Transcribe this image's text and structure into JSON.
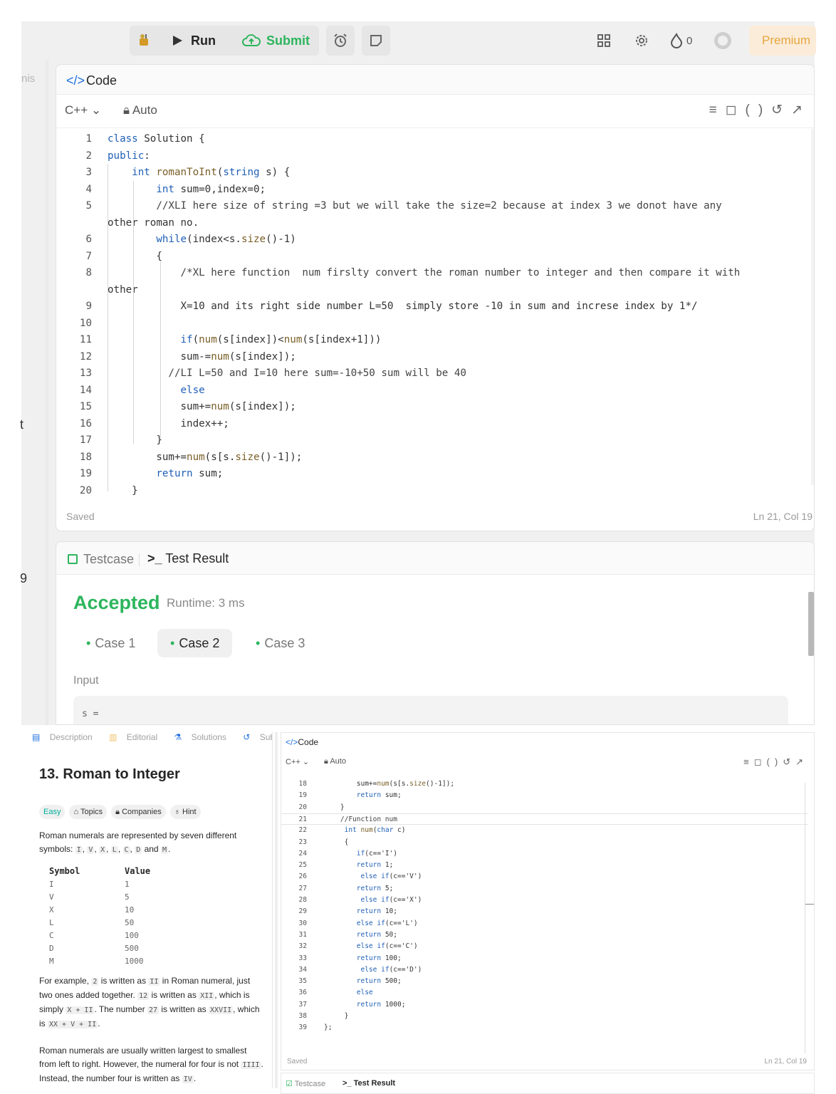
{
  "topbar": {
    "run_label": "Run",
    "submit_label": "Submit",
    "points": "0",
    "premium_label": "Premium"
  },
  "left_strip": {
    "partial_tab": "nis",
    "partial_t": "t",
    "partial_9": "9"
  },
  "editor": {
    "title": "Code",
    "language": "C++",
    "mode": "Auto",
    "status": "Saved",
    "cursor": "Ln 21, Col 19",
    "lines": [
      {
        "n": "1",
        "text": "class Solution {"
      },
      {
        "n": "2",
        "text": "public:"
      },
      {
        "n": "3",
        "text": "    int romanToInt(string s) {"
      },
      {
        "n": "4",
        "text": "        int sum=0,index=0;"
      },
      {
        "n": "5",
        "text": "        //XLI here size of string =3 but we will take the size=2 because at index 3 we donot have any"
      },
      {
        "n": "",
        "text": "other roman no."
      },
      {
        "n": "6",
        "text": "        while(index<s.size()-1)"
      },
      {
        "n": "7",
        "text": "        {"
      },
      {
        "n": "8",
        "text": "            /*XL here function  num firslty convert the roman number to integer and then compare it with"
      },
      {
        "n": "",
        "text": "other"
      },
      {
        "n": "9",
        "text": "            X=10 and its right side number L=50  simply store -10 in sum and increse index by 1*/"
      },
      {
        "n": "10",
        "text": ""
      },
      {
        "n": "11",
        "text": "            if(num(s[index])<num(s[index+1]))"
      },
      {
        "n": "12",
        "text": "            sum-=num(s[index]);"
      },
      {
        "n": "13",
        "text": "          //LI L=50 and I=10 here sum=-10+50 sum will be 40"
      },
      {
        "n": "14",
        "text": "            else"
      },
      {
        "n": "15",
        "text": "            sum+=num(s[index]);"
      },
      {
        "n": "16",
        "text": "            index++;"
      },
      {
        "n": "17",
        "text": "        }"
      },
      {
        "n": "18",
        "text": "        sum+=num(s[s.size()-1]);"
      },
      {
        "n": "19",
        "text": "        return sum;"
      },
      {
        "n": "20",
        "text": "    }"
      }
    ]
  },
  "result": {
    "tab_testcase": "Testcase",
    "tab_result": "Test Result",
    "verdict": "Accepted",
    "runtime": "Runtime: 3 ms",
    "cases": [
      "Case 1",
      "Case 2",
      "Case 3"
    ],
    "active_case": 1,
    "input_label": "Input",
    "input_value": "s ="
  },
  "problem": {
    "tabs": [
      "Description",
      "Editorial",
      "Solutions",
      "Submi"
    ],
    "title": "13. Roman to Integer",
    "difficulty": "Easy",
    "chips": [
      "Topics",
      "Companies",
      "Hint"
    ],
    "table_headers": [
      "Symbol",
      "Value"
    ],
    "table_rows": [
      [
        "I",
        "1"
      ],
      [
        "V",
        "5"
      ],
      [
        "X",
        "10"
      ],
      [
        "L",
        "50"
      ],
      [
        "C",
        "100"
      ],
      [
        "D",
        "500"
      ],
      [
        "M",
        "1000"
      ]
    ]
  },
  "editor2": {
    "title": "Code",
    "language": "C++",
    "mode": "Auto",
    "status": "Saved",
    "cursor": "Ln 21, Col 19",
    "tab_testcase": "Testcase",
    "tab_result": "Test Result",
    "lines": [
      {
        "n": "18",
        "text": "        sum+=num(s[s.size()-1]);"
      },
      {
        "n": "19",
        "text": "        return sum;"
      },
      {
        "n": "20",
        "text": "    }"
      },
      {
        "n": "21",
        "text": "    //Function num"
      },
      {
        "n": "22",
        "text": "     int num(char c)"
      },
      {
        "n": "23",
        "text": "     {"
      },
      {
        "n": "24",
        "text": "        if(c=='I')"
      },
      {
        "n": "25",
        "text": "        return 1;"
      },
      {
        "n": "26",
        "text": "         else if(c=='V')"
      },
      {
        "n": "27",
        "text": "        return 5;"
      },
      {
        "n": "28",
        "text": "         else if(c=='X')"
      },
      {
        "n": "29",
        "text": "        return 10;"
      },
      {
        "n": "30",
        "text": "        else if(c=='L')"
      },
      {
        "n": "31",
        "text": "        return 50;"
      },
      {
        "n": "32",
        "text": "        else if(c=='C')"
      },
      {
        "n": "33",
        "text": "        return 100;"
      },
      {
        "n": "34",
        "text": "         else if(c=='D')"
      },
      {
        "n": "35",
        "text": "        return 500;"
      },
      {
        "n": "36",
        "text": "        else"
      },
      {
        "n": "37",
        "text": "        return 1000;"
      },
      {
        "n": "38",
        "text": "     }"
      },
      {
        "n": "39",
        "text": "};"
      }
    ]
  }
}
